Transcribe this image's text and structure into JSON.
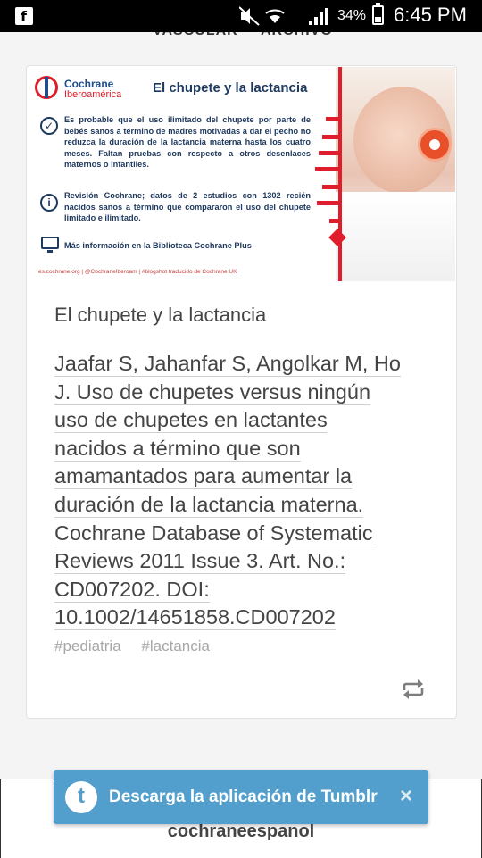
{
  "status_bar": {
    "battery": "34%",
    "time": "6:45 PM"
  },
  "top_nav": {
    "item1": "VASCULAR",
    "item2": "ARCHIVO"
  },
  "post": {
    "banner": {
      "logo_line1": "Cochrane",
      "logo_line2": "Iberoamérica",
      "title": "El chupete y la lactancia",
      "text1": "Es probable que el uso ilimitado del chupete por parte de bebés sanos a término de madres motivadas a dar el pecho no reduzca la duración de la lactancia materna hasta los cuatro meses. Faltan pruebas con respecto a otros desenlaces maternos o infantiles.",
      "text2": "Revisión Cochrane; datos de 2 estudios con 1302 recién nacidos sanos a término que compararon el uso del chupete limitado e ilimitado.",
      "text3": "Más información en la Biblioteca Cochrane Plus",
      "footer": "es.cochrane.org | @CochraneIberoam | #blogshot traducido de Cochrane UK"
    },
    "title": "El chupete y la lactancia",
    "citation_lines": [
      "Jaafar S, Jahanfar S, Angolkar M, Ho",
      "J. Uso de chupetes versus ningún",
      "uso de chupetes en lactantes",
      "nacidos a término que son",
      "amamantados para aumentar la",
      "duración de la lactancia materna.",
      "Cochrane Database of Systematic",
      "Reviews 2011 Issue 3. Art. No.:",
      "CD007202. DOI:",
      "10.1002/14651858.CD007202"
    ],
    "tags": [
      "#pediatria",
      "#lactancia"
    ],
    "reblog_icon": "reblog-icon"
  },
  "toast": {
    "logo_letter": "t",
    "text": "Descarga la aplicación de Tumblr",
    "close": "×"
  },
  "bottom": {
    "username": "cochraneespanol"
  },
  "colors": {
    "tumblr_blue": "#529ecc",
    "cochrane_red": "#e01d2a",
    "cochrane_blue": "#1f4e8c"
  }
}
